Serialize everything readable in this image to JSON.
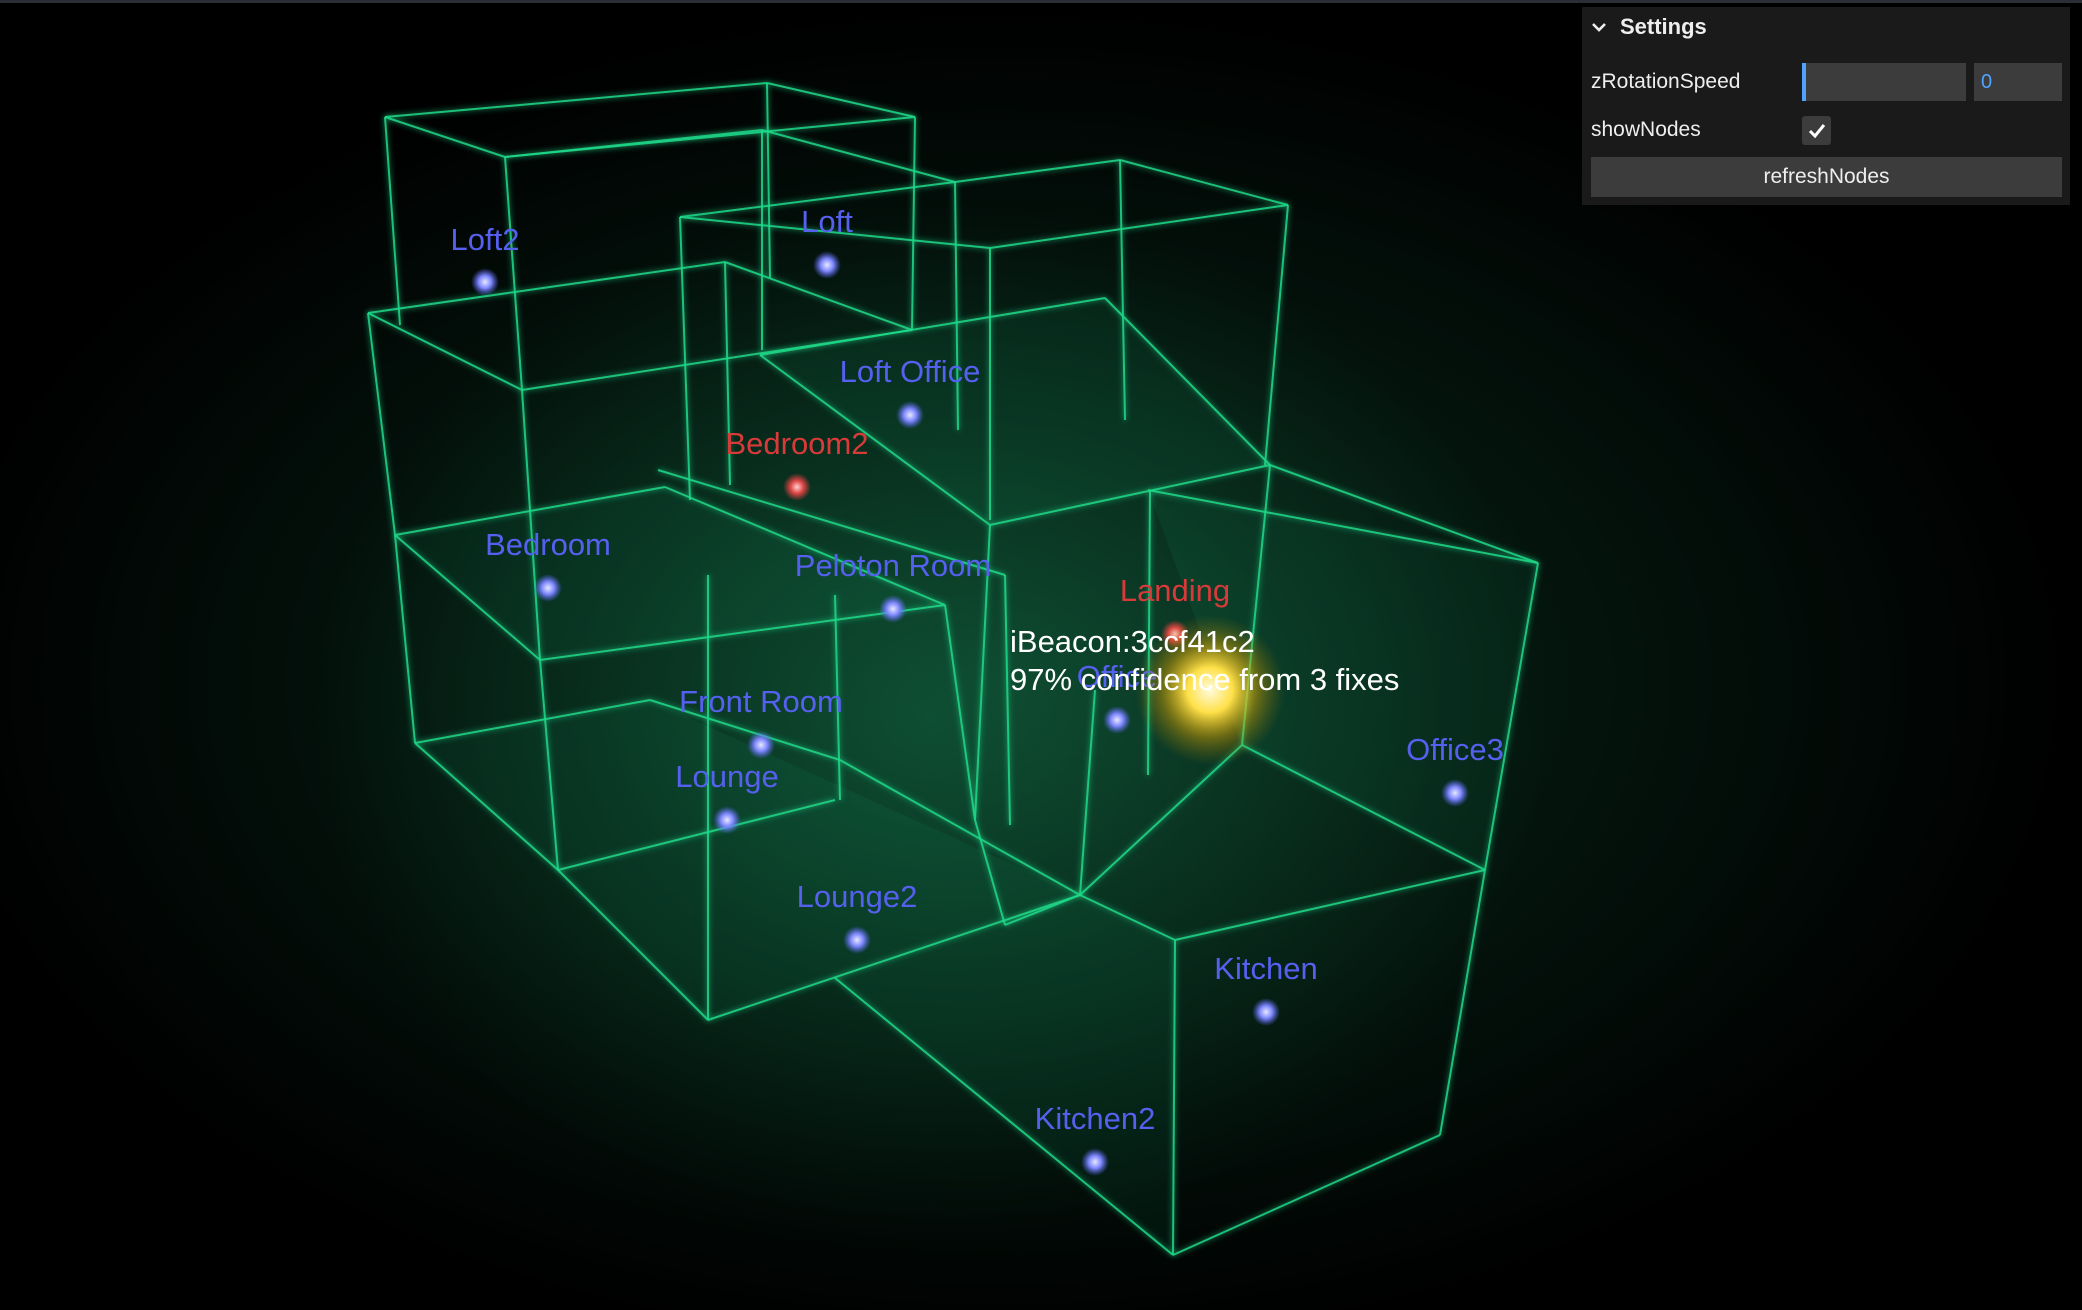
{
  "scene": {
    "nodes": [
      {
        "name": "Loft2",
        "state": "online"
      },
      {
        "name": "Loft",
        "state": "online"
      },
      {
        "name": "Loft Office",
        "state": "online"
      },
      {
        "name": "Bedroom2",
        "state": "offline"
      },
      {
        "name": "Bedroom",
        "state": "online"
      },
      {
        "name": "Peloton Room",
        "state": "online"
      },
      {
        "name": "Landing",
        "state": "offline"
      },
      {
        "name": "Office",
        "state": "online"
      },
      {
        "name": "Front Room",
        "state": "online"
      },
      {
        "name": "Lounge",
        "state": "online"
      },
      {
        "name": "Office3",
        "state": "online"
      },
      {
        "name": "Lounge2",
        "state": "online"
      },
      {
        "name": "Kitchen",
        "state": "online"
      },
      {
        "name": "Kitchen2",
        "state": "online"
      }
    ],
    "device": {
      "id": "iBeacon:3ccf41c2",
      "confidence_text": "97% confidence from 3 fixes"
    },
    "colors": {
      "wireframe": "#1fd98a",
      "node_online": "#5560ee",
      "node_offline": "#d83a3a",
      "device": "#ffe14a"
    }
  },
  "settings": {
    "title": "Settings",
    "zRotationSpeed": {
      "label": "zRotationSpeed",
      "value": "0"
    },
    "showNodes": {
      "label": "showNodes",
      "checked": true
    },
    "refresh_label": "refreshNodes"
  }
}
